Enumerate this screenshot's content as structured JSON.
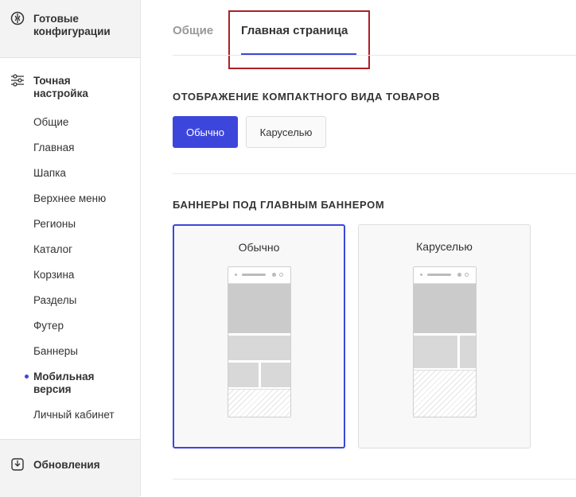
{
  "sidebar": {
    "top_label": "Готовые конфигурации",
    "section_label": "Точная настройка",
    "items": [
      {
        "label": "Общие"
      },
      {
        "label": "Главная"
      },
      {
        "label": "Шапка"
      },
      {
        "label": "Верхнее меню"
      },
      {
        "label": "Регионы"
      },
      {
        "label": "Каталог"
      },
      {
        "label": "Корзина"
      },
      {
        "label": "Разделы"
      },
      {
        "label": "Футер"
      },
      {
        "label": "Баннеры"
      },
      {
        "label": "Мобильная версия",
        "active": true
      },
      {
        "label": "Личный кабинет"
      }
    ],
    "bottom_label": "Обновления"
  },
  "tabs": [
    {
      "label": "Общие"
    },
    {
      "label": "Главная страница",
      "active": true
    }
  ],
  "compact_section": {
    "title": "ОТОБРАЖЕНИЕ КОМПАКТНОГО ВИДА ТОВАРОВ",
    "options": [
      {
        "label": "Обычно",
        "selected": true
      },
      {
        "label": "Каруселью"
      }
    ]
  },
  "banners_section": {
    "title": "БАННЕРЫ ПОД ГЛАВНЫМ БАННЕРОМ",
    "options": [
      {
        "label": "Обычно",
        "selected": true
      },
      {
        "label": "Каруселью"
      }
    ]
  },
  "colors": {
    "accent": "#3d46db",
    "highlight_frame": "#b01f24"
  }
}
